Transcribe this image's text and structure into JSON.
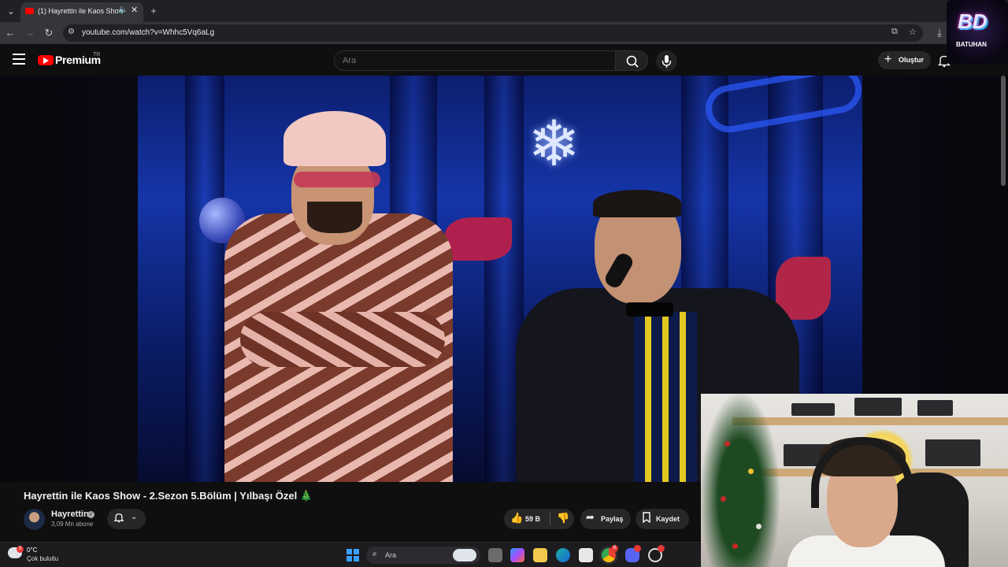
{
  "browser": {
    "tab_title": "(1) Hayrettin ile Kaos Show",
    "url": "youtube.com/watch?v=Whhc5Vq6aLg"
  },
  "masthead": {
    "logo_text": "Premium",
    "region_code": "TR",
    "search_placeholder": "Ara",
    "create_label": "Oluştur"
  },
  "stream_overlay": {
    "logo_initials": "BD",
    "logo_name": "BATUHAN"
  },
  "video": {
    "title": "Hayrettin ile Kaos Show - 2.Sezon 5.Bölüm | Yılbaşı Özel 🎄",
    "channel_name": "Hayrettin",
    "subscriber_count": "3,09 Mn abone",
    "likes": "59 B",
    "share_label": "Paylaş",
    "save_label": "Kaydet"
  },
  "taskbar": {
    "weather_temp": "0°C",
    "weather_desc": "Çok bulutlu",
    "weather_badge": "3",
    "search_label": "Ara",
    "chrome_badge": "8"
  },
  "colors": {
    "youtube_red": "#ff0000",
    "background": "#0f0f0f",
    "pill": "#272727"
  }
}
